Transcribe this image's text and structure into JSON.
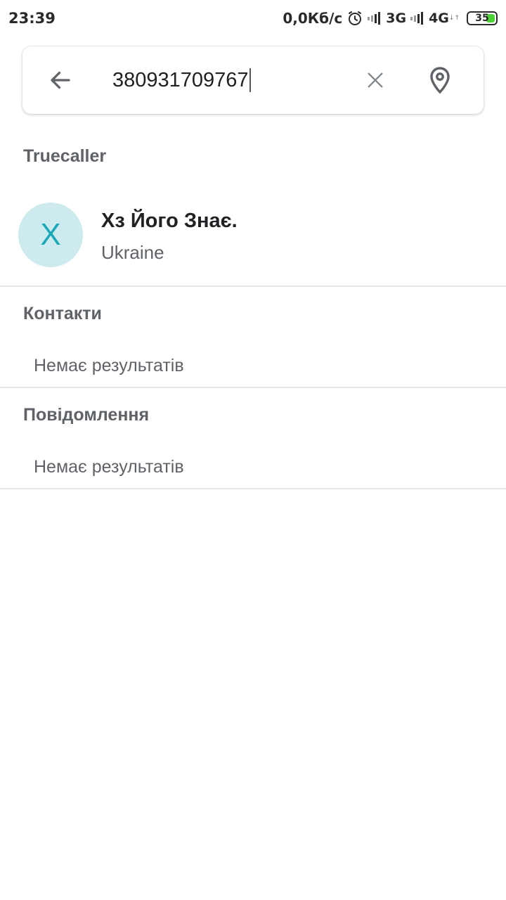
{
  "status_bar": {
    "time": "23:39",
    "net_speed": "0,0Кб/с",
    "net1": "3G",
    "net2": "4G",
    "battery": "35",
    "battery_color": "#4cd137"
  },
  "search": {
    "value": "380931709767",
    "back_icon": "arrow-left-icon",
    "clear_icon": "close-icon",
    "location_icon": "location-pin-icon"
  },
  "sections": {
    "truecaller": {
      "title": "Truecaller",
      "result": {
        "avatar_letter": "Х",
        "name": "Хз Його Знає.",
        "country": "Ukraine",
        "avatar_bg": "#cdeaef",
        "avatar_fg": "#1aa7b8"
      }
    },
    "contacts": {
      "title": "Контакти",
      "empty": "Немає результатів"
    },
    "messages": {
      "title": "Повідомлення",
      "empty": "Немає результатів"
    }
  }
}
